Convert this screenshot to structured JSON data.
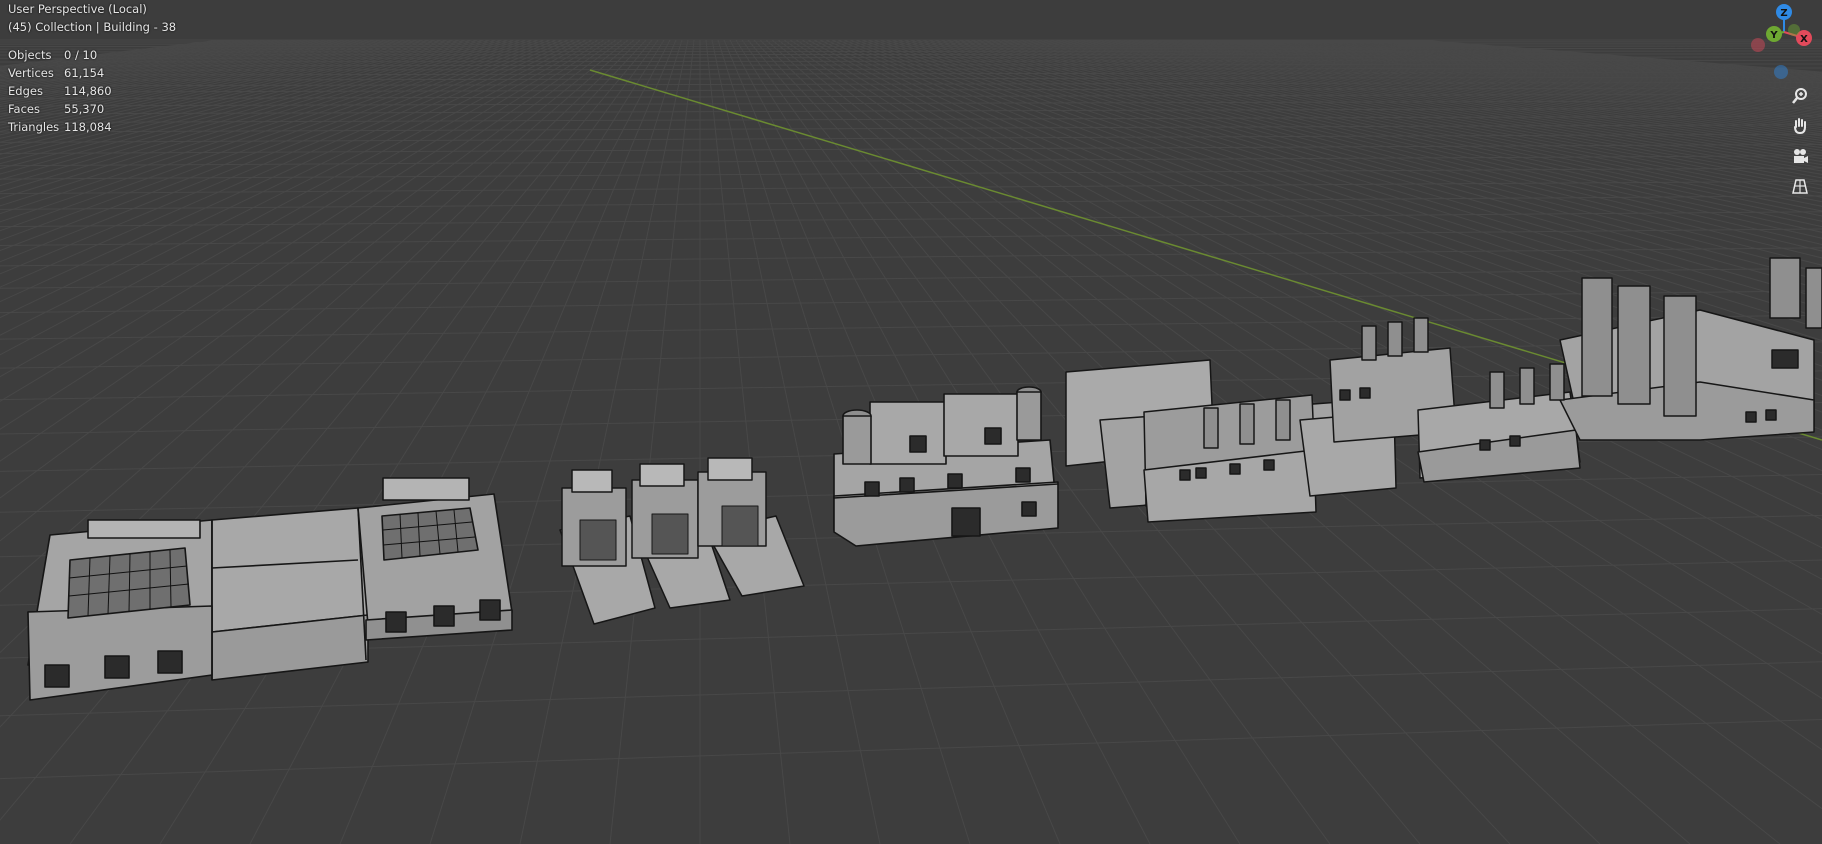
{
  "viewport": {
    "title": "User Perspective (Local)",
    "context": "(45) Collection | Building - 38"
  },
  "stats": [
    {
      "label": "Objects",
      "value": "0 / 10"
    },
    {
      "label": "Vertices",
      "value": "61,154"
    },
    {
      "label": "Edges",
      "value": "114,860"
    },
    {
      "label": "Faces",
      "value": "55,370"
    },
    {
      "label": "Triangles",
      "value": "118,084"
    }
  ],
  "gizmo": {
    "z_label": "Z",
    "y_label": "Y",
    "x_label": "X",
    "colors": {
      "x": "#e24a5b",
      "y": "#6ea832",
      "z": "#2f8ae5"
    }
  },
  "tools": [
    {
      "name": "zoom-icon"
    },
    {
      "name": "pan-hand-icon"
    },
    {
      "name": "camera-view-icon"
    },
    {
      "name": "perspective-grid-icon"
    }
  ],
  "colors": {
    "background": "#3d3d3d",
    "grid": "#484848",
    "x_axis": "#6a8a31",
    "building_light": "#a2a2a2",
    "building_dark": "#888888",
    "edge": "#161616"
  }
}
